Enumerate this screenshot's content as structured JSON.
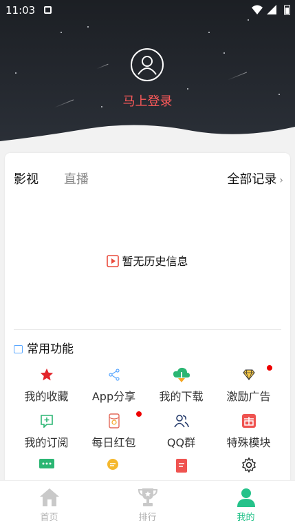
{
  "status_bar": {
    "time": "11:03"
  },
  "header": {
    "login_text": "马上登录"
  },
  "history": {
    "tabs": [
      "影视",
      "直播"
    ],
    "all_records": "全部记录",
    "empty_text": "暂无历史信息"
  },
  "functions": {
    "title": "常用功能",
    "items": [
      {
        "label": "我的收藏",
        "icon": "star-icon"
      },
      {
        "label": "App分享",
        "icon": "share-icon"
      },
      {
        "label": "我的下载",
        "icon": "cloud-download-icon"
      },
      {
        "label": "激励广告",
        "icon": "diamond-icon"
      },
      {
        "label": "我的订阅",
        "icon": "subscribe-icon"
      },
      {
        "label": "每日红包",
        "icon": "red-packet-icon"
      },
      {
        "label": "QQ群",
        "icon": "group-icon"
      },
      {
        "label": "特殊模块",
        "icon": "gift-icon"
      }
    ],
    "extra_icons": [
      "message-icon",
      "chat-icon",
      "note-icon",
      "settings-icon"
    ]
  },
  "bottom_nav": [
    {
      "label": "首页",
      "icon": "home-icon"
    },
    {
      "label": "排行",
      "icon": "trophy-icon"
    },
    {
      "label": "我的",
      "icon": "profile-icon"
    }
  ],
  "colors": {
    "accent": "#25c28a",
    "login": "#ff5a5a",
    "badge": "#e00000"
  }
}
